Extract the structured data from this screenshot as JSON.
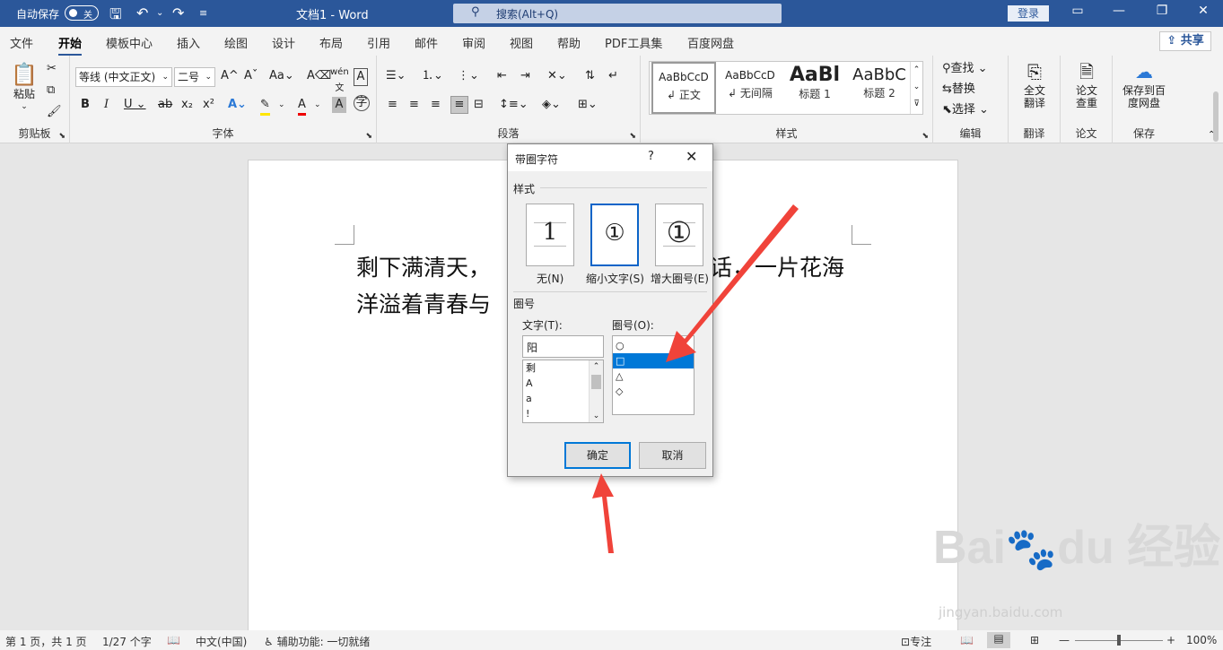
{
  "titlebar": {
    "autosave_label": "自动保存",
    "autosave_state": "关",
    "doc_title": "文档1 - Word",
    "search_placeholder": "搜索(Alt+Q)",
    "login": "登录"
  },
  "tabs": [
    "文件",
    "开始",
    "模板中心",
    "插入",
    "绘图",
    "设计",
    "布局",
    "引用",
    "邮件",
    "审阅",
    "视图",
    "帮助",
    "PDF工具集",
    "百度网盘"
  ],
  "active_tab": "开始",
  "share": "共享",
  "ribbon": {
    "clipboard": {
      "paste": "粘贴",
      "label": "剪贴板"
    },
    "font": {
      "name": "等线 (中文正文)",
      "size": "二号",
      "label": "字体"
    },
    "paragraph": {
      "label": "段落"
    },
    "styles": {
      "label": "样式",
      "items": [
        {
          "sample": "AaBbCcD",
          "name": "正文"
        },
        {
          "sample": "AaBbCcD",
          "name": "无间隔"
        },
        {
          "sample": "AaBl",
          "name": "标题 1"
        },
        {
          "sample": "AaBbC",
          "name": "标题 2"
        }
      ]
    },
    "editing": {
      "find": "查找",
      "replace": "替换",
      "select": "选择",
      "label": "编辑"
    },
    "translate": {
      "btn": "全文翻译",
      "label": "翻译"
    },
    "paper": {
      "btn": "论文查重",
      "label": "论文"
    },
    "save": {
      "btn": "保存到百度网盘",
      "label": "保存"
    }
  },
  "document": {
    "line1_left": "剩下满清天，",
    "line1_right": "话，一片花海",
    "line2_left": "洋溢着青春与"
  },
  "dialog": {
    "title": "带圈字符",
    "help": "?",
    "style_section": "样式",
    "options": [
      {
        "label": "无(N)",
        "glyph": "1"
      },
      {
        "label": "缩小文字(S)",
        "glyph": "①"
      },
      {
        "label": "增大圈号(E)",
        "glyph": "①"
      }
    ],
    "selected_option": 1,
    "circle_section": "圈号",
    "text_label": "文字(T):",
    "text_value": "阳",
    "text_list": [
      "剩",
      "A",
      "a",
      "!"
    ],
    "circle_label": "圈号(O):",
    "circle_list": [
      "○",
      "□",
      "△",
      "◇"
    ],
    "selected_circle": 1,
    "ok": "确定",
    "cancel": "取消"
  },
  "statusbar": {
    "page": "第 1 页，共 1 页",
    "words": "1/27 个字",
    "lang": "中文(中国)",
    "accessibility": "辅助功能: 一切就绪",
    "focus": "专注",
    "zoom": "100%"
  },
  "colors": {
    "accent": "#2b579a",
    "arrow": "#f0433a",
    "selection": "#0078d7"
  }
}
